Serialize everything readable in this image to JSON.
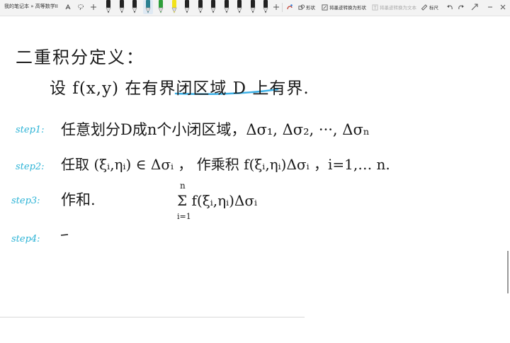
{
  "window": {
    "title": "我的笔记本 » 高等数学II"
  },
  "toolbar": {
    "shape_label": "形状",
    "ink_to_shape_label": "将墨迹转换为形状",
    "ink_to_text_label": "将墨迹转换为文本",
    "ruler_label": "标尺",
    "pens": [
      {
        "name": "pen-black-1",
        "color": "#222222"
      },
      {
        "name": "pen-black-2",
        "color": "#222222"
      },
      {
        "name": "pen-black-3",
        "color": "#222222"
      },
      {
        "name": "pen-teal",
        "color": "#2a7f8f"
      },
      {
        "name": "pen-green",
        "color": "#2e9e3a"
      },
      {
        "name": "pen-yellow-highlighter",
        "color": "#f2e21b"
      },
      {
        "name": "pen-black-4",
        "color": "#222222"
      },
      {
        "name": "pen-black-5",
        "color": "#222222"
      },
      {
        "name": "pen-black-6",
        "color": "#222222"
      },
      {
        "name": "pen-black-7",
        "color": "#222222"
      },
      {
        "name": "pen-black-8",
        "color": "#222222"
      },
      {
        "name": "pen-black-9",
        "color": "#222222"
      },
      {
        "name": "pen-black-10",
        "color": "#222222"
      }
    ]
  },
  "note": {
    "heading": "二重积分定义：",
    "line1": "设 f(x,y) 在有界闭区域 D 上有界.",
    "step1_label": "step1:",
    "step1_text": "任意划分D成n个小闭区域，Δσ₁, Δσ₂, ···, Δσₙ",
    "step2_label": "step2:",
    "step2_text": "任取 (ξᵢ,ηᵢ) ∈ Δσᵢ ，  作乘积   f(ξᵢ,ηᵢ)Δσᵢ ，i=1,… n.",
    "step3_label": "step3:",
    "step3_text": "作和.",
    "step3_formula": "Σ f(ξᵢ,ηᵢ)Δσᵢ",
    "sum_top": "n",
    "sum_bottom": "i=1",
    "step4_label": "step4:",
    "step4_text": "—"
  },
  "colors": {
    "ink_black": "#1a1a1a",
    "ink_cyan": "#2bb3d6",
    "highlight_blue": "#3cb0e6"
  }
}
